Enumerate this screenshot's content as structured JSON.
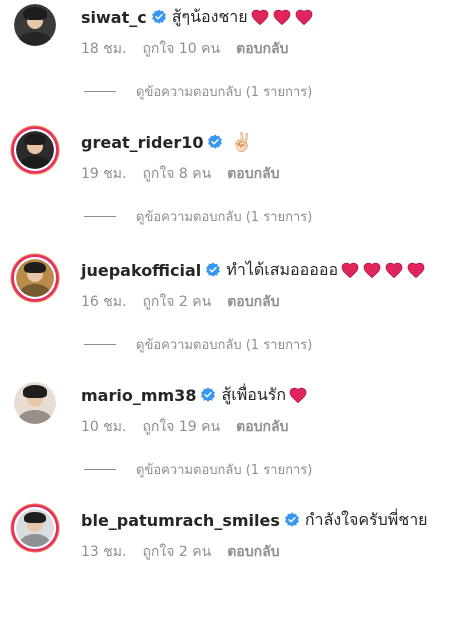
{
  "comments": [
    {
      "username": "siwat_c",
      "text": "สู้ๆน้องชาย",
      "emoji": "",
      "hearts": 3,
      "time": "18 ชม.",
      "likes": "ถูกใจ 10 คน",
      "reply": "ตอบกลับ",
      "view_replies": "ดูข้อความตอบกลับ (1 รายการ)",
      "avatar_color": "#3a3a3a",
      "ring": false
    },
    {
      "username": "great_rider10",
      "text": "",
      "emoji": "✌🏻",
      "hearts": 0,
      "time": "19 ชม.",
      "likes": "ถูกใจ 8 คน",
      "reply": "ตอบกลับ",
      "view_replies": "ดูข้อความตอบกลับ (1 รายการ)",
      "avatar_color": "#2b2b2b",
      "ring": true
    },
    {
      "username": "juepakofficial",
      "text": "ทำได้เสมอออออ",
      "emoji": "",
      "hearts": 4,
      "time": "16 ชม.",
      "likes": "ถูกใจ 2 คน",
      "reply": "ตอบกลับ",
      "view_replies": "ดูข้อความตอบกลับ (1 รายการ)",
      "avatar_color": "#b98a4a",
      "ring": true
    },
    {
      "username": "mario_mm38",
      "text": "สู้เพื่อนรัก",
      "emoji": "",
      "hearts": 1,
      "time": "10 ชม.",
      "likes": "ถูกใจ 19 คน",
      "reply": "ตอบกลับ",
      "view_replies": "ดูข้อความตอบกลับ (1 รายการ)",
      "avatar_color": "#e9dcd2",
      "ring": false
    },
    {
      "username": "ble_patumrach_smiles",
      "text": "กำลังใจครับพี่ชาย",
      "emoji": "",
      "hearts": 0,
      "time": "13 ชม.",
      "likes": "ถูกใจ 2 คน",
      "reply": "ตอบกลับ",
      "view_replies": "",
      "avatar_color": "#d9dde0",
      "ring": true
    }
  ],
  "colors": {
    "verified_badge": "#3897f0",
    "heart": "#e0245e",
    "muted_text": "#8e8e8e"
  },
  "icons": {
    "verified": "verified-badge-icon",
    "heart": "red-heart-icon"
  }
}
